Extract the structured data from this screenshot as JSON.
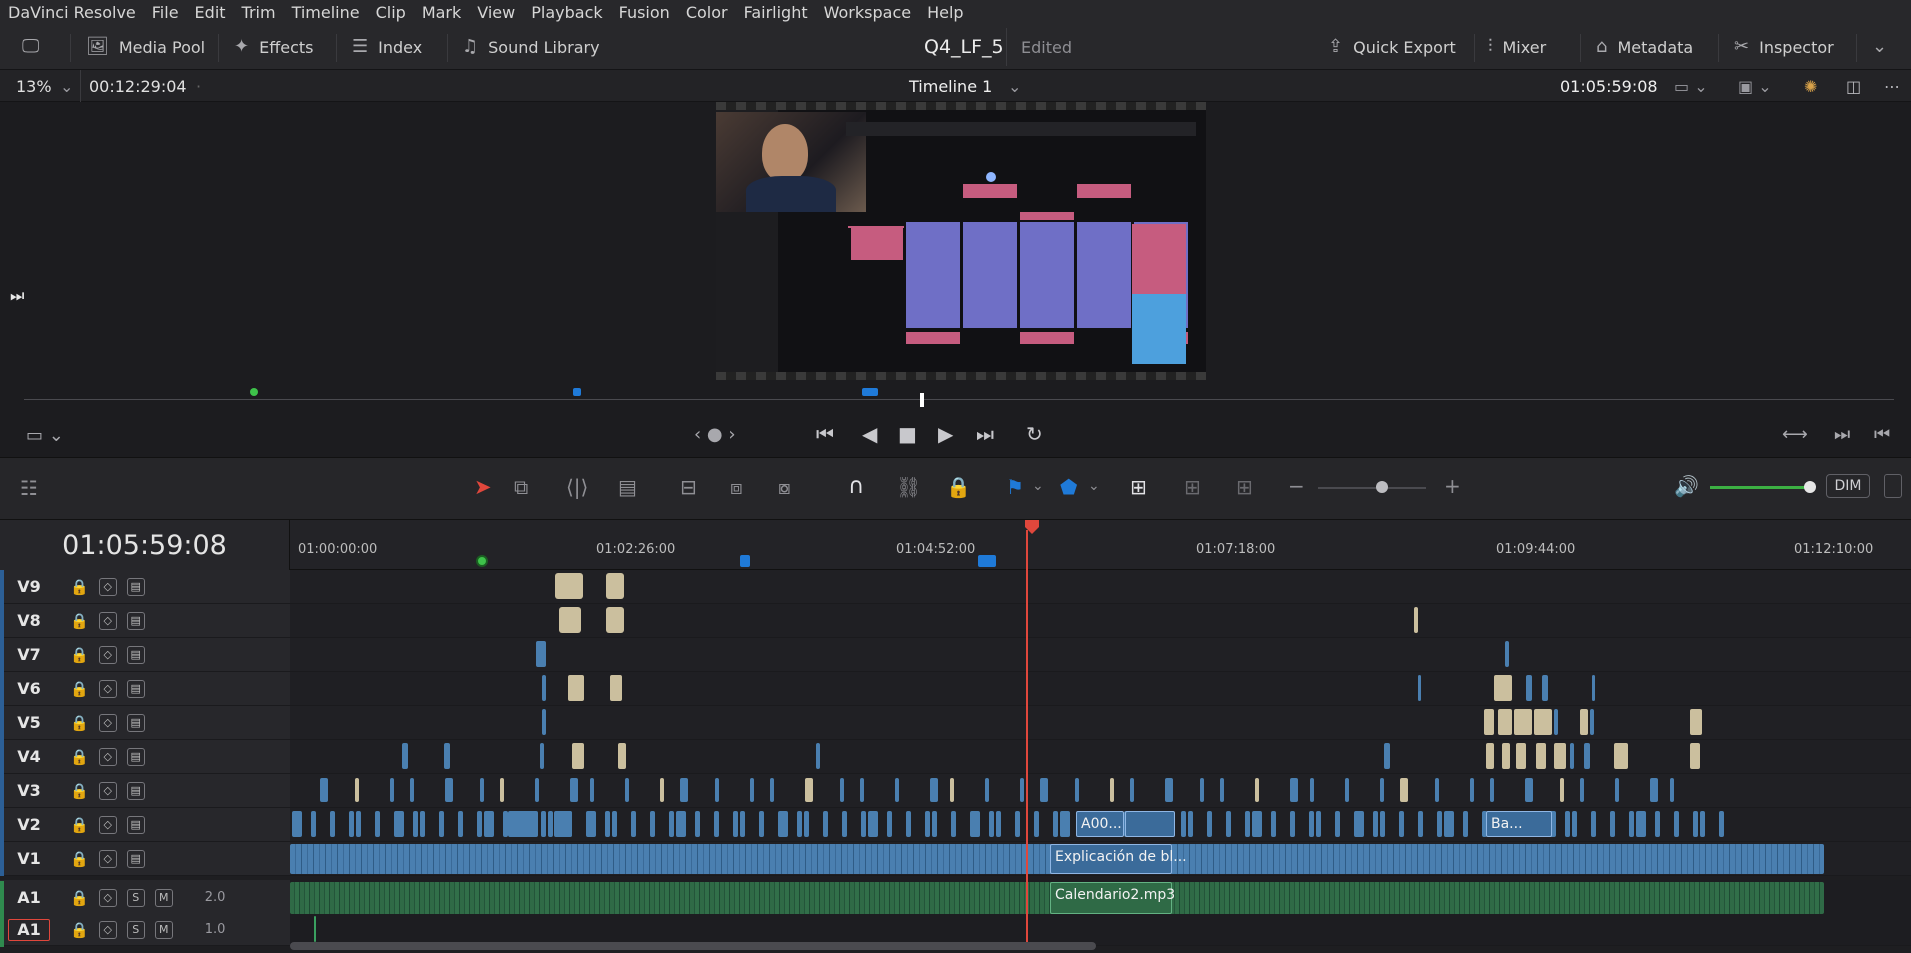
{
  "menu": [
    "DaVinci Resolve",
    "File",
    "Edit",
    "Trim",
    "Timeline",
    "Clip",
    "Mark",
    "View",
    "Playback",
    "Fusion",
    "Color",
    "Fairlight",
    "Workspace",
    "Help"
  ],
  "toolbar": {
    "media_pool": "Media Pool",
    "effects": "Effects",
    "index": "Index",
    "sound_library": "Sound Library",
    "project_name": "Q4_LF_5",
    "project_status": "Edited",
    "quick_export": "Quick Export",
    "mixer": "Mixer",
    "metadata": "Metadata",
    "inspector": "Inspector"
  },
  "viewer_bar": {
    "zoom": "13%",
    "source_tc": "00:12:29:04",
    "timeline_name": "Timeline 1",
    "record_tc": "01:05:59:08"
  },
  "audio": {
    "dim_label": "DIM"
  },
  "timeline": {
    "current_tc": "01:05:59:08",
    "ruler": [
      "01:00:00:00",
      "01:02:26:00",
      "01:04:52:00",
      "01:07:18:00",
      "01:09:44:00",
      "01:12:10:00"
    ],
    "video_tracks": [
      "V9",
      "V8",
      "V7",
      "V6",
      "V5",
      "V4",
      "V3",
      "V2",
      "V1"
    ],
    "audio_tracks": [
      {
        "name": "A1",
        "channels": "2.0"
      },
      {
        "name": "A1",
        "channels": "1.0"
      }
    ],
    "solo_label": "S",
    "mute_label": "M",
    "clip_labels": {
      "v2_a": "A00...",
      "v2_b": "Ba...",
      "v1": "Explicación de bl...",
      "a1": "Calendario2.mp3"
    }
  },
  "colors": {
    "video_clip": "#4a7fb0",
    "still_clip": "#cbbf9e",
    "audio_clip": "#2f6a46",
    "playhead": "#e0473c",
    "marker_blue": "#1f7ad8",
    "marker_green": "#3ec24a"
  }
}
